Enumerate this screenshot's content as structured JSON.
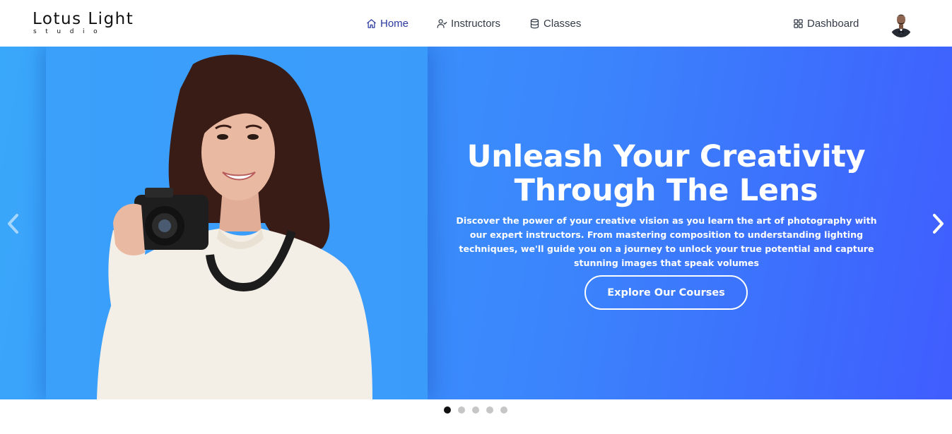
{
  "logo": {
    "title": "Lotus Light",
    "subtitle": "studio"
  },
  "nav": {
    "items": [
      {
        "label": "Home",
        "icon": "home-icon",
        "active": true
      },
      {
        "label": "Instructors",
        "icon": "user-check-icon",
        "active": false
      },
      {
        "label": "Classes",
        "icon": "database-icon",
        "active": false
      }
    ],
    "dashboard": {
      "label": "Dashboard",
      "icon": "grid-icon"
    },
    "avatar": {
      "icon": "user-avatar"
    }
  },
  "hero": {
    "heading_line1": "Unleash Your Creativity",
    "heading_line2": "Through The Lens",
    "description": "Discover the power of your creative vision as you learn the art of photography with our expert instructors. From mastering composition to understanding lighting techniques, we'll guide you on a journey to unlock your true potential and capture stunning images that speak volumes",
    "cta_label": "Explore Our Courses",
    "prev_icon": "chevron-left-icon",
    "next_icon": "chevron-right-icon"
  },
  "carousel": {
    "slide_count": 5,
    "active_index": 0
  },
  "colors": {
    "accent": "#2b3aa0",
    "hero_gradient_start": "#3aa8fa",
    "hero_gradient_end": "#405dfe",
    "text_white": "#ffffff",
    "dot_active": "#111111",
    "dot_inactive": "#c6c6c6"
  }
}
